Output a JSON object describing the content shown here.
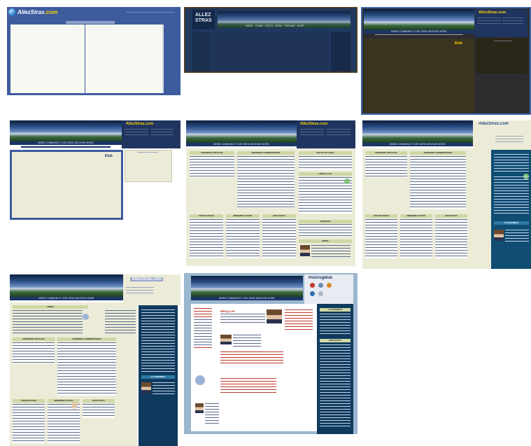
{
  "site_name": "AllezStras",
  "site_domain": ".com",
  "logo_text": "AllezStras.com",
  "logo_stacked_top": "ALLEZ",
  "logo_stacked_bottom": "STRAS",
  "nav_text": "NEWS COMMUNITY CHE DESK ARCHIVE MORE",
  "nav_short": "NEWS · COMM · STATS · ARCH · FORUMS · SHOP",
  "elub_text": "Elub",
  "last_logo": "RuGrugBub",
  "match_title": "Meng-Lee",
  "sections": {
    "latest_articles": "DERNIERS ARTICLES",
    "comments": "DERNIERS COMMENTAIRES",
    "matches": "MATCH DU JOUR",
    "links": "LIENS ALLEZ",
    "forum": "FORUM STRAS",
    "results": "RESULTATS",
    "classement": "CLASSEMENT",
    "members": "MEMBRES ACTIFS",
    "sondage": "SONDAGE",
    "news": "NEWS"
  },
  "colors": {
    "blue_frame": "#3d5c9e",
    "navy": "#1f3560",
    "olive": "#3b3520",
    "cream": "#ebebd8",
    "teal": "#0f4d73",
    "accent_yellow": "#ffd200",
    "red_accent": "#c0392b"
  }
}
